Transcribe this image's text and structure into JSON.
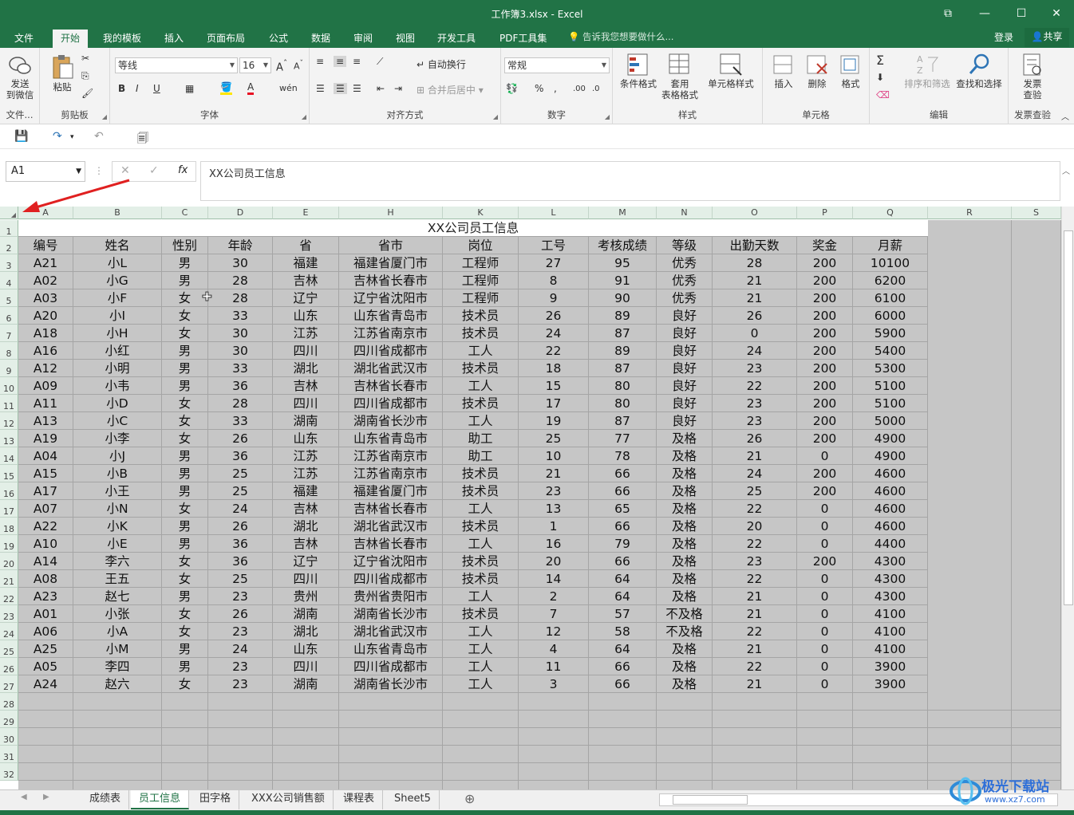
{
  "window": {
    "title": "工作簿3.xlsx - Excel"
  },
  "tabs": [
    "文件",
    "开始",
    "我的模板",
    "插入",
    "页面布局",
    "公式",
    "数据",
    "审阅",
    "视图",
    "开发工具",
    "PDF工具集"
  ],
  "active_tab": "开始",
  "tell_me": "告诉我您想要做什么...",
  "account": {
    "login": "登录",
    "share": "共享"
  },
  "ribbon": {
    "send": {
      "line1": "发送",
      "line2": "到微信",
      "group": "文件..."
    },
    "clipboard": {
      "paste": "粘贴",
      "group": "剪贴板"
    },
    "font": {
      "name": "等线",
      "size": "16",
      "group": "字体"
    },
    "align": {
      "wrap": "自动换行",
      "merge": "合并后居中",
      "group": "对齐方式"
    },
    "number": {
      "format": "常规",
      "group": "数字"
    },
    "styles": {
      "cond": "条件格式",
      "table1": "套用",
      "table2": "表格格式",
      "cell": "单元格样式",
      "group": "样式"
    },
    "cells": {
      "insert": "插入",
      "delete": "删除",
      "format": "格式",
      "group": "单元格"
    },
    "edit": {
      "sort": "排序和筛选",
      "find": "查找和选择",
      "group": "编辑"
    },
    "invoice": {
      "line1": "发票",
      "line2": "查验",
      "group": "发票查验"
    }
  },
  "formula_bar": {
    "name_box": "A1",
    "formula": "XX公司员工信息"
  },
  "columns": [
    "A",
    "B",
    "C",
    "D",
    "E",
    "H",
    "K",
    "L",
    "M",
    "N",
    "O",
    "P",
    "Q",
    "R",
    "S"
  ],
  "sheet_title": "XX公司员工信息",
  "headers": [
    "编号",
    "姓名",
    "性别",
    "年龄",
    "省",
    "省市",
    "岗位",
    "工号",
    "考核成绩",
    "等级",
    "出勤天数",
    "奖金",
    "月薪"
  ],
  "rows": [
    [
      "A21",
      "小L",
      "男",
      "30",
      "福建",
      "福建省厦门市",
      "工程师",
      "27",
      "95",
      "优秀",
      "28",
      "200",
      "10100"
    ],
    [
      "A02",
      "小G",
      "男",
      "28",
      "吉林",
      "吉林省长春市",
      "工程师",
      "8",
      "91",
      "优秀",
      "21",
      "200",
      "6200"
    ],
    [
      "A03",
      "小F",
      "女",
      "28",
      "辽宁",
      "辽宁省沈阳市",
      "工程师",
      "9",
      "90",
      "优秀",
      "21",
      "200",
      "6100"
    ],
    [
      "A20",
      "小I",
      "女",
      "33",
      "山东",
      "山东省青岛市",
      "技术员",
      "26",
      "89",
      "良好",
      "26",
      "200",
      "6000"
    ],
    [
      "A18",
      "小H",
      "女",
      "30",
      "江苏",
      "江苏省南京市",
      "技术员",
      "24",
      "87",
      "良好",
      "0",
      "200",
      "5900"
    ],
    [
      "A16",
      "小红",
      "男",
      "30",
      "四川",
      "四川省成都市",
      "工人",
      "22",
      "89",
      "良好",
      "24",
      "200",
      "5400"
    ],
    [
      "A12",
      "小明",
      "男",
      "33",
      "湖北",
      "湖北省武汉市",
      "技术员",
      "18",
      "87",
      "良好",
      "23",
      "200",
      "5300"
    ],
    [
      "A09",
      "小韦",
      "男",
      "36",
      "吉林",
      "吉林省长春市",
      "工人",
      "15",
      "80",
      "良好",
      "22",
      "200",
      "5100"
    ],
    [
      "A11",
      "小D",
      "女",
      "28",
      "四川",
      "四川省成都市",
      "技术员",
      "17",
      "80",
      "良好",
      "23",
      "200",
      "5100"
    ],
    [
      "A13",
      "小C",
      "女",
      "33",
      "湖南",
      "湖南省长沙市",
      "工人",
      "19",
      "87",
      "良好",
      "23",
      "200",
      "5000"
    ],
    [
      "A19",
      "小李",
      "女",
      "26",
      "山东",
      "山东省青岛市",
      "助工",
      "25",
      "77",
      "及格",
      "26",
      "200",
      "4900"
    ],
    [
      "A04",
      "小J",
      "男",
      "36",
      "江苏",
      "江苏省南京市",
      "助工",
      "10",
      "78",
      "及格",
      "21",
      "0",
      "4900"
    ],
    [
      "A15",
      "小B",
      "男",
      "25",
      "江苏",
      "江苏省南京市",
      "技术员",
      "21",
      "66",
      "及格",
      "24",
      "200",
      "4600"
    ],
    [
      "A17",
      "小王",
      "男",
      "25",
      "福建",
      "福建省厦门市",
      "技术员",
      "23",
      "66",
      "及格",
      "25",
      "200",
      "4600"
    ],
    [
      "A07",
      "小N",
      "女",
      "24",
      "吉林",
      "吉林省长春市",
      "工人",
      "13",
      "65",
      "及格",
      "22",
      "0",
      "4600"
    ],
    [
      "A22",
      "小K",
      "男",
      "26",
      "湖北",
      "湖北省武汉市",
      "技术员",
      "1",
      "66",
      "及格",
      "20",
      "0",
      "4600"
    ],
    [
      "A10",
      "小E",
      "男",
      "36",
      "吉林",
      "吉林省长春市",
      "工人",
      "16",
      "79",
      "及格",
      "22",
      "0",
      "4400"
    ],
    [
      "A14",
      "李六",
      "女",
      "36",
      "辽宁",
      "辽宁省沈阳市",
      "技术员",
      "20",
      "66",
      "及格",
      "23",
      "200",
      "4300"
    ],
    [
      "A08",
      "王五",
      "女",
      "25",
      "四川",
      "四川省成都市",
      "技术员",
      "14",
      "64",
      "及格",
      "22",
      "0",
      "4300"
    ],
    [
      "A23",
      "赵七",
      "男",
      "23",
      "贵州",
      "贵州省贵阳市",
      "工人",
      "2",
      "64",
      "及格",
      "21",
      "0",
      "4300"
    ],
    [
      "A01",
      "小张",
      "女",
      "26",
      "湖南",
      "湖南省长沙市",
      "技术员",
      "7",
      "57",
      "不及格",
      "21",
      "0",
      "4100"
    ],
    [
      "A06",
      "小A",
      "女",
      "23",
      "湖北",
      "湖北省武汉市",
      "工人",
      "12",
      "58",
      "不及格",
      "22",
      "0",
      "4100"
    ],
    [
      "A25",
      "小M",
      "男",
      "24",
      "山东",
      "山东省青岛市",
      "工人",
      "4",
      "64",
      "及格",
      "21",
      "0",
      "4100"
    ],
    [
      "A05",
      "李四",
      "男",
      "23",
      "四川",
      "四川省成都市",
      "工人",
      "11",
      "66",
      "及格",
      "22",
      "0",
      "3900"
    ],
    [
      "A24",
      "赵六",
      "女",
      "23",
      "湖南",
      "湖南省长沙市",
      "工人",
      "3",
      "66",
      "及格",
      "21",
      "0",
      "3900"
    ]
  ],
  "row_numbers": [
    "1",
    "2",
    "3",
    "4",
    "5",
    "6",
    "7",
    "8",
    "9",
    "10",
    "11",
    "12",
    "13",
    "14",
    "15",
    "16",
    "17",
    "18",
    "19",
    "20",
    "21",
    "22",
    "23",
    "24",
    "25",
    "26",
    "27",
    "28",
    "29",
    "30",
    "31",
    "32"
  ],
  "sheet_tabs": [
    "成绩表",
    "员工信息",
    "田字格",
    "XXX公司销售额",
    "课程表",
    "Sheet5"
  ],
  "active_sheet": "员工信息",
  "watermark": {
    "line1": "极光下载站",
    "line2": "www.xz7.com"
  },
  "colors": {
    "accent": "#217346",
    "selection": "#c6c6c6"
  }
}
